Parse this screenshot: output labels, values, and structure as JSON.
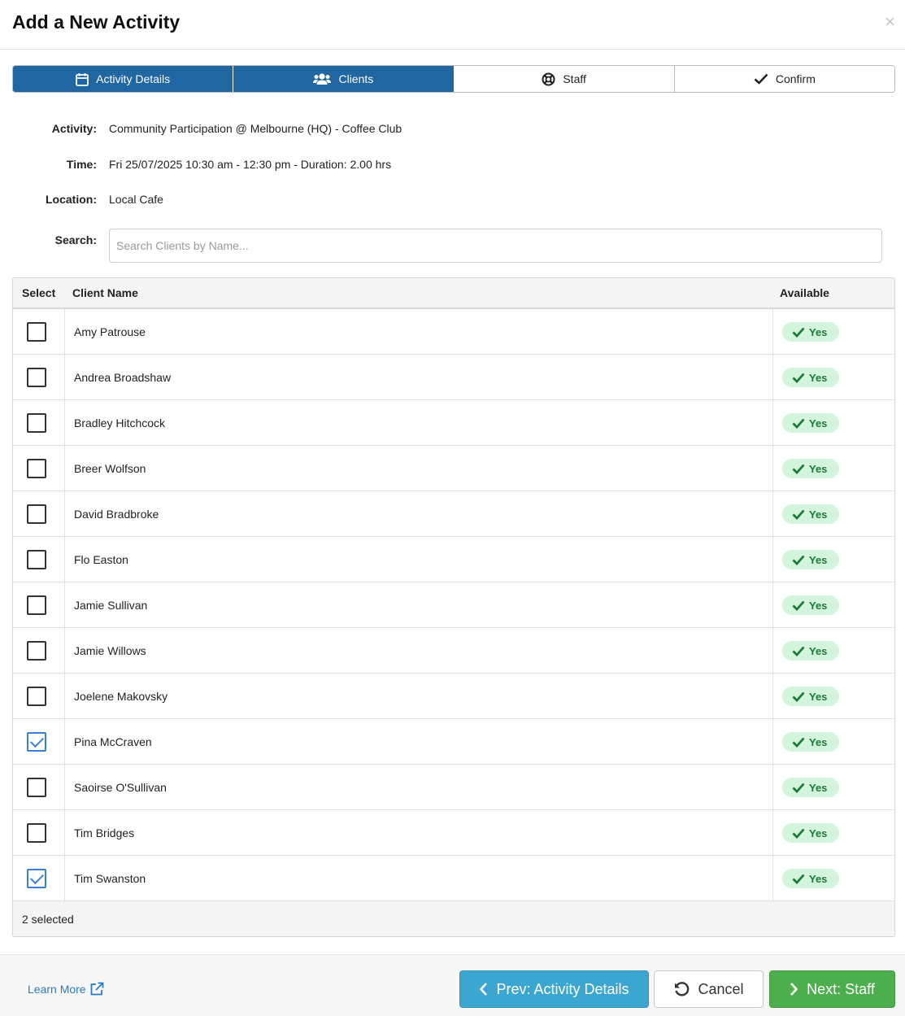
{
  "header": {
    "title": "Add a New Activity",
    "close": "×"
  },
  "steps": [
    {
      "label": "Activity Details",
      "icon": "calendar-icon",
      "active": true
    },
    {
      "label": "Clients",
      "icon": "users-icon",
      "active": true
    },
    {
      "label": "Staff",
      "icon": "life-ring-icon",
      "active": false
    },
    {
      "label": "Confirm",
      "icon": "check-icon",
      "active": false
    }
  ],
  "details": {
    "activity_label": "Activity:",
    "activity_value": "Community Participation @ Melbourne (HQ) - Coffee Club",
    "time_label": "Time:",
    "time_value": "Fri 25/07/2025 10:30 am - 12:30 pm - Duration: 2.00 hrs",
    "location_label": "Location:",
    "location_value": "Local Cafe",
    "search_label": "Search:",
    "search_placeholder": "Search Clients by Name...",
    "search_value": ""
  },
  "table": {
    "columns": {
      "select": "Select",
      "name": "Client Name",
      "available": "Available"
    },
    "rows": [
      {
        "name": "Amy Patrouse",
        "available": "Yes",
        "selected": false
      },
      {
        "name": "Andrea Broadshaw",
        "available": "Yes",
        "selected": false
      },
      {
        "name": "Bradley Hitchcock",
        "available": "Yes",
        "selected": false
      },
      {
        "name": "Breer Wolfson",
        "available": "Yes",
        "selected": false
      },
      {
        "name": "David Bradbroke",
        "available": "Yes",
        "selected": false
      },
      {
        "name": "Flo Easton",
        "available": "Yes",
        "selected": false
      },
      {
        "name": "Jamie Sullivan",
        "available": "Yes",
        "selected": false
      },
      {
        "name": "Jamie Willows",
        "available": "Yes",
        "selected": false
      },
      {
        "name": "Joelene Makovsky",
        "available": "Yes",
        "selected": false
      },
      {
        "name": "Pina McCraven",
        "available": "Yes",
        "selected": true
      },
      {
        "name": "Saoirse O'Sullivan",
        "available": "Yes",
        "selected": false
      },
      {
        "name": "Tim Bridges",
        "available": "Yes",
        "selected": false
      },
      {
        "name": "Tim Swanston",
        "available": "Yes",
        "selected": true
      }
    ],
    "footer": "2 selected"
  },
  "footer": {
    "learn_more": "Learn More",
    "prev_label": "Prev: Activity Details",
    "cancel_label": "Cancel",
    "next_label": "Next: Staff"
  },
  "colors": {
    "primary": "#1f66a3",
    "badge_bg": "#d3f5dc",
    "badge_text": "#1e7a38",
    "prev_button": "#3ba6cf",
    "next_button": "#4cae4c",
    "checkbox_checked": "#3b7de0"
  }
}
